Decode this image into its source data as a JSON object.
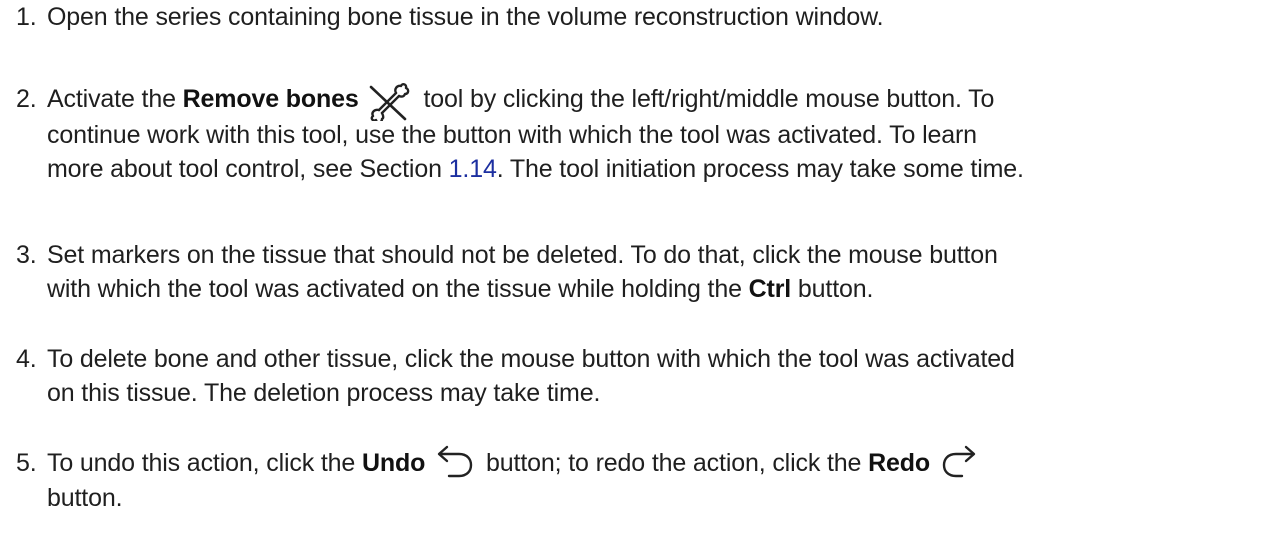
{
  "steps": [
    {
      "number": "1.",
      "text": "Open the series containing bone tissue in the volume reconstruction window."
    },
    {
      "number": "2.",
      "pre": "Activate the ",
      "bold": "Remove bones",
      "icon": "remove-bones-icon",
      "post": " tool by clicking the left/right/middle mouse button.  To",
      "line2": "continue work with this tool, use the button with which the tool was activated.  To learn",
      "line3_pre": "more about tool control, see Section ",
      "link": "1.14",
      "line3_post": ".  The tool initiation process may take some time."
    },
    {
      "number": "3.",
      "line1": "Set markers on the tissue that should not be deleted.  To do that, click the mouse button",
      "line2_pre": "with which the tool was activated on the tissue while holding the ",
      "bold": "Ctrl",
      "line2_post": " button."
    },
    {
      "number": "4.",
      "line1": "To delete bone and other tissue, click the mouse button with which the tool was activated",
      "line2": "on this tissue.  The deletion process may take time."
    },
    {
      "number": "5.",
      "pre": "To undo this action, click the ",
      "bold1": "Undo",
      "icon1": "undo-icon",
      "mid": " button; to redo the action, click the ",
      "bold2": "Redo",
      "icon2": "redo-icon",
      "line2": "button."
    }
  ],
  "colors": {
    "text": "#1f1f1f",
    "link": "#1c2fa0"
  }
}
